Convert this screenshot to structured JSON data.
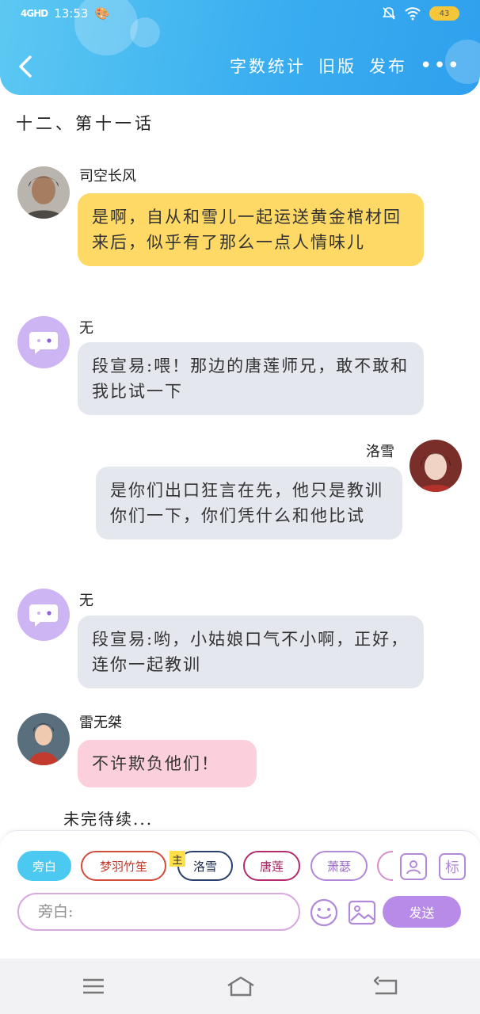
{
  "status_bar": {
    "network": "4GHD",
    "time": "13:53",
    "battery": "43"
  },
  "header": {
    "actions": [
      {
        "label": "字数统计"
      },
      {
        "label": "旧版"
      },
      {
        "label": "发布"
      }
    ],
    "more_label": "•••"
  },
  "chapter": {
    "title": "十二、第十一话"
  },
  "messages": [
    {
      "speaker": "司空长风",
      "text": "是啊，自从和雪儿一起运送黄金棺材回来后，似乎有了那么一点人情味儿",
      "side": "left",
      "color": "#ffd966"
    },
    {
      "speaker": "无",
      "text": "段宣易:喂！那边的唐莲师兄，敢不敢和我比试一下",
      "side": "left",
      "color": "#e4e7ee"
    },
    {
      "speaker": "洛雪",
      "text": "是你们出口狂言在先，他只是教训你们一下，你们凭什么和他比试",
      "side": "right",
      "color": "#e4e7ee"
    },
    {
      "speaker": "无",
      "text": "段宣易:哟，小姑娘口气不小啊，正好，连你一起教训",
      "side": "left",
      "color": "#e4e7ee"
    },
    {
      "speaker": "雷无桀",
      "text": "不许欺负他们！",
      "side": "left",
      "color": "#fbd0dc"
    }
  ],
  "to_be_continued": "未完待续...",
  "composer": {
    "roles": [
      {
        "label": "旁白",
        "selected": true
      },
      {
        "label": "梦羽竹笙"
      },
      {
        "label": "洛雪",
        "badge": "主"
      },
      {
        "label": "唐莲"
      },
      {
        "label": "萧瑟"
      }
    ],
    "tag_label": "标",
    "input_placeholder": "旁白:",
    "send_label": "发送"
  }
}
